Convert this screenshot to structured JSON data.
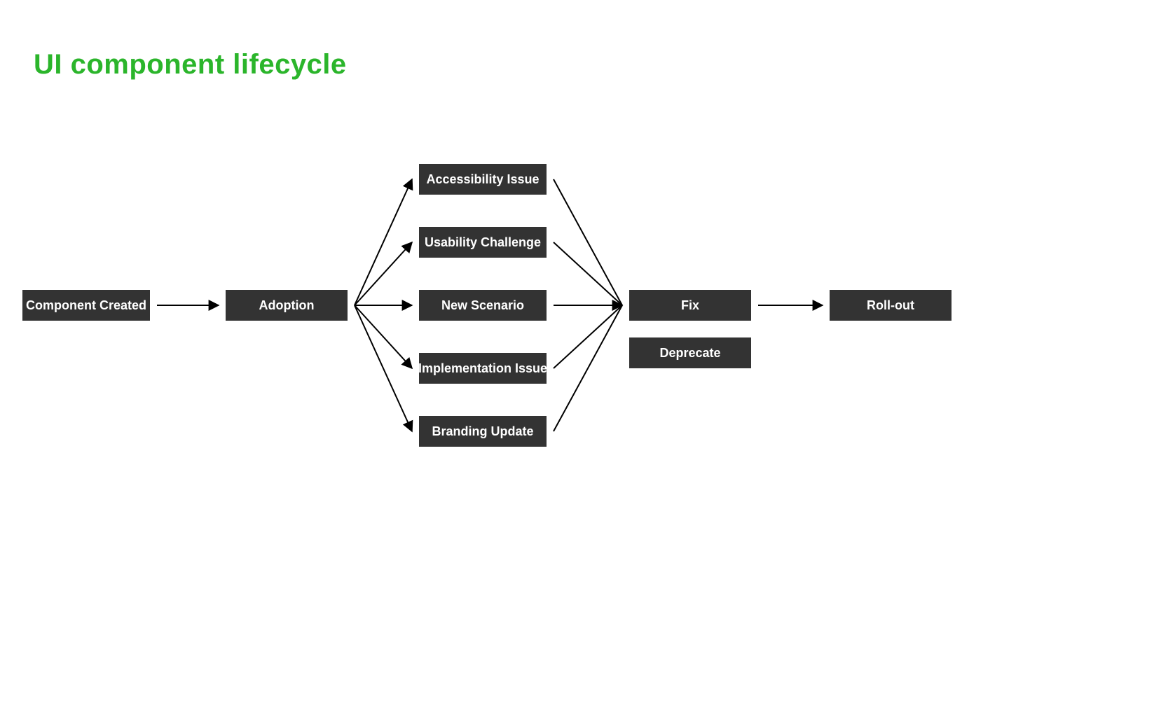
{
  "title": "UI component lifecycle",
  "nodes": {
    "created": "Component Created",
    "adoption": "Adoption",
    "access": "Accessibility Issue",
    "usability": "Usability Challenge",
    "scenario": "New Scenario",
    "impl": "Implementation Issue",
    "brand": "Branding Update",
    "fix": "Fix",
    "deprecate": "Deprecate",
    "rollout": "Roll-out"
  },
  "colors": {
    "title": "#2bb52b",
    "node_bg": "#333333",
    "node_fg": "#ffffff",
    "edge": "#000000",
    "canvas": "#ffffff"
  },
  "edges": [
    {
      "from": "created",
      "to": "adoption",
      "arrow": true
    },
    {
      "from": "adoption",
      "to": "access",
      "arrow": true
    },
    {
      "from": "adoption",
      "to": "usability",
      "arrow": true
    },
    {
      "from": "adoption",
      "to": "scenario",
      "arrow": true
    },
    {
      "from": "adoption",
      "to": "impl",
      "arrow": true
    },
    {
      "from": "adoption",
      "to": "brand",
      "arrow": true
    },
    {
      "from": "access",
      "to": "fix",
      "arrow": false
    },
    {
      "from": "usability",
      "to": "fix",
      "arrow": false
    },
    {
      "from": "scenario",
      "to": "fix",
      "arrow": true
    },
    {
      "from": "impl",
      "to": "fix",
      "arrow": false
    },
    {
      "from": "brand",
      "to": "fix",
      "arrow": false
    },
    {
      "from": "fix",
      "to": "rollout",
      "arrow": true
    }
  ]
}
